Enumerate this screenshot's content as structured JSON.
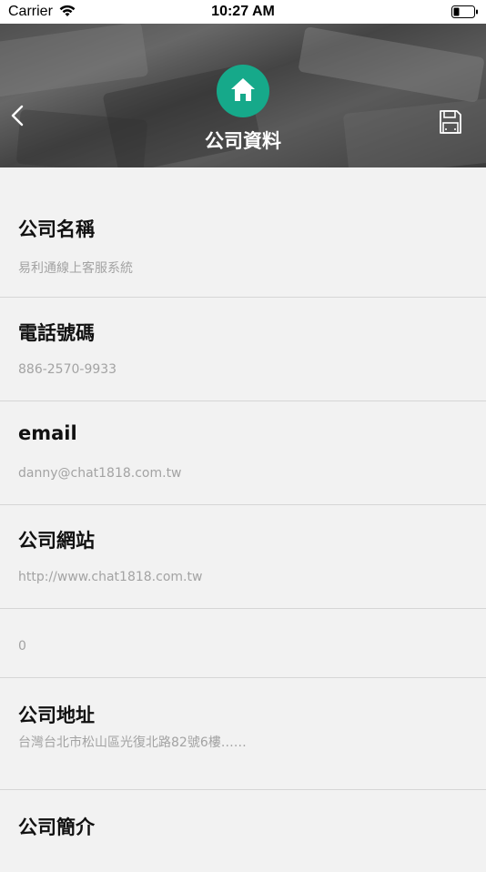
{
  "status_bar": {
    "carrier": "Carrier",
    "time": "10:27 AM"
  },
  "header": {
    "title": "公司資料",
    "logo_icon": "home-icon",
    "back_icon": "chevron-left-icon",
    "save_icon": "floppy-disk-icon",
    "accent_color": "#16a98a"
  },
  "fields": [
    {
      "label": "公司名稱",
      "value": "易利通線上客服系統"
    },
    {
      "label": "電話號碼",
      "value": "886-2570-9933"
    },
    {
      "label": "email",
      "value": "danny@chat1818.com.tw"
    },
    {
      "label": "公司網站",
      "value": "http://www.chat1818.com.tw"
    },
    {
      "label": "",
      "value": "0"
    },
    {
      "label": "公司地址",
      "value": "台灣台北市松山區光復北路82號6樓……"
    },
    {
      "label": "公司簡介",
      "value": ""
    }
  ]
}
